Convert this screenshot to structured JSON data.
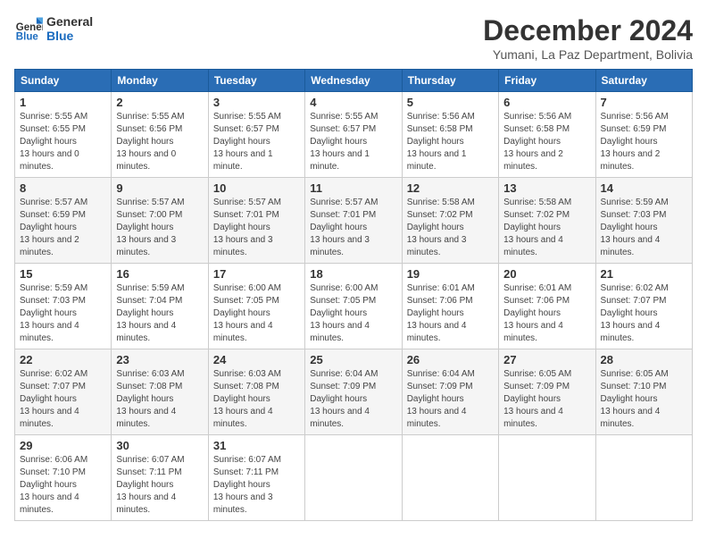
{
  "header": {
    "logo_general": "General",
    "logo_blue": "Blue",
    "month_title": "December 2024",
    "subtitle": "Yumani, La Paz Department, Bolivia"
  },
  "days_of_week": [
    "Sunday",
    "Monday",
    "Tuesday",
    "Wednesday",
    "Thursday",
    "Friday",
    "Saturday"
  ],
  "weeks": [
    [
      {
        "day": 1,
        "sunrise": "5:55 AM",
        "sunset": "6:55 PM",
        "daylight": "13 hours and 0 minutes."
      },
      {
        "day": 2,
        "sunrise": "5:55 AM",
        "sunset": "6:56 PM",
        "daylight": "13 hours and 0 minutes."
      },
      {
        "day": 3,
        "sunrise": "5:55 AM",
        "sunset": "6:57 PM",
        "daylight": "13 hours and 1 minute."
      },
      {
        "day": 4,
        "sunrise": "5:55 AM",
        "sunset": "6:57 PM",
        "daylight": "13 hours and 1 minute."
      },
      {
        "day": 5,
        "sunrise": "5:56 AM",
        "sunset": "6:58 PM",
        "daylight": "13 hours and 1 minute."
      },
      {
        "day": 6,
        "sunrise": "5:56 AM",
        "sunset": "6:58 PM",
        "daylight": "13 hours and 2 minutes."
      },
      {
        "day": 7,
        "sunrise": "5:56 AM",
        "sunset": "6:59 PM",
        "daylight": "13 hours and 2 minutes."
      }
    ],
    [
      {
        "day": 8,
        "sunrise": "5:57 AM",
        "sunset": "6:59 PM",
        "daylight": "13 hours and 2 minutes."
      },
      {
        "day": 9,
        "sunrise": "5:57 AM",
        "sunset": "7:00 PM",
        "daylight": "13 hours and 3 minutes."
      },
      {
        "day": 10,
        "sunrise": "5:57 AM",
        "sunset": "7:01 PM",
        "daylight": "13 hours and 3 minutes."
      },
      {
        "day": 11,
        "sunrise": "5:57 AM",
        "sunset": "7:01 PM",
        "daylight": "13 hours and 3 minutes."
      },
      {
        "day": 12,
        "sunrise": "5:58 AM",
        "sunset": "7:02 PM",
        "daylight": "13 hours and 3 minutes."
      },
      {
        "day": 13,
        "sunrise": "5:58 AM",
        "sunset": "7:02 PM",
        "daylight": "13 hours and 4 minutes."
      },
      {
        "day": 14,
        "sunrise": "5:59 AM",
        "sunset": "7:03 PM",
        "daylight": "13 hours and 4 minutes."
      }
    ],
    [
      {
        "day": 15,
        "sunrise": "5:59 AM",
        "sunset": "7:03 PM",
        "daylight": "13 hours and 4 minutes."
      },
      {
        "day": 16,
        "sunrise": "5:59 AM",
        "sunset": "7:04 PM",
        "daylight": "13 hours and 4 minutes."
      },
      {
        "day": 17,
        "sunrise": "6:00 AM",
        "sunset": "7:05 PM",
        "daylight": "13 hours and 4 minutes."
      },
      {
        "day": 18,
        "sunrise": "6:00 AM",
        "sunset": "7:05 PM",
        "daylight": "13 hours and 4 minutes."
      },
      {
        "day": 19,
        "sunrise": "6:01 AM",
        "sunset": "7:06 PM",
        "daylight": "13 hours and 4 minutes."
      },
      {
        "day": 20,
        "sunrise": "6:01 AM",
        "sunset": "7:06 PM",
        "daylight": "13 hours and 4 minutes."
      },
      {
        "day": 21,
        "sunrise": "6:02 AM",
        "sunset": "7:07 PM",
        "daylight": "13 hours and 4 minutes."
      }
    ],
    [
      {
        "day": 22,
        "sunrise": "6:02 AM",
        "sunset": "7:07 PM",
        "daylight": "13 hours and 4 minutes."
      },
      {
        "day": 23,
        "sunrise": "6:03 AM",
        "sunset": "7:08 PM",
        "daylight": "13 hours and 4 minutes."
      },
      {
        "day": 24,
        "sunrise": "6:03 AM",
        "sunset": "7:08 PM",
        "daylight": "13 hours and 4 minutes."
      },
      {
        "day": 25,
        "sunrise": "6:04 AM",
        "sunset": "7:09 PM",
        "daylight": "13 hours and 4 minutes."
      },
      {
        "day": 26,
        "sunrise": "6:04 AM",
        "sunset": "7:09 PM",
        "daylight": "13 hours and 4 minutes."
      },
      {
        "day": 27,
        "sunrise": "6:05 AM",
        "sunset": "7:09 PM",
        "daylight": "13 hours and 4 minutes."
      },
      {
        "day": 28,
        "sunrise": "6:05 AM",
        "sunset": "7:10 PM",
        "daylight": "13 hours and 4 minutes."
      }
    ],
    [
      {
        "day": 29,
        "sunrise": "6:06 AM",
        "sunset": "7:10 PM",
        "daylight": "13 hours and 4 minutes."
      },
      {
        "day": 30,
        "sunrise": "6:07 AM",
        "sunset": "7:11 PM",
        "daylight": "13 hours and 4 minutes."
      },
      {
        "day": 31,
        "sunrise": "6:07 AM",
        "sunset": "7:11 PM",
        "daylight": "13 hours and 3 minutes."
      },
      null,
      null,
      null,
      null
    ]
  ]
}
